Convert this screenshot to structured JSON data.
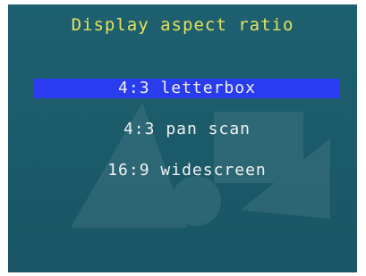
{
  "title": "Display aspect ratio",
  "menu": {
    "items": [
      {
        "label": "4:3 letterbox",
        "selected": true
      },
      {
        "label": "4:3 pan scan",
        "selected": false
      },
      {
        "label": "16:9 widescreen",
        "selected": false
      }
    ]
  },
  "colors": {
    "background": "#1c5c6c",
    "title": "#e8e25a",
    "item_text": "#f2f2f2",
    "selection": "#2a3cf0"
  }
}
